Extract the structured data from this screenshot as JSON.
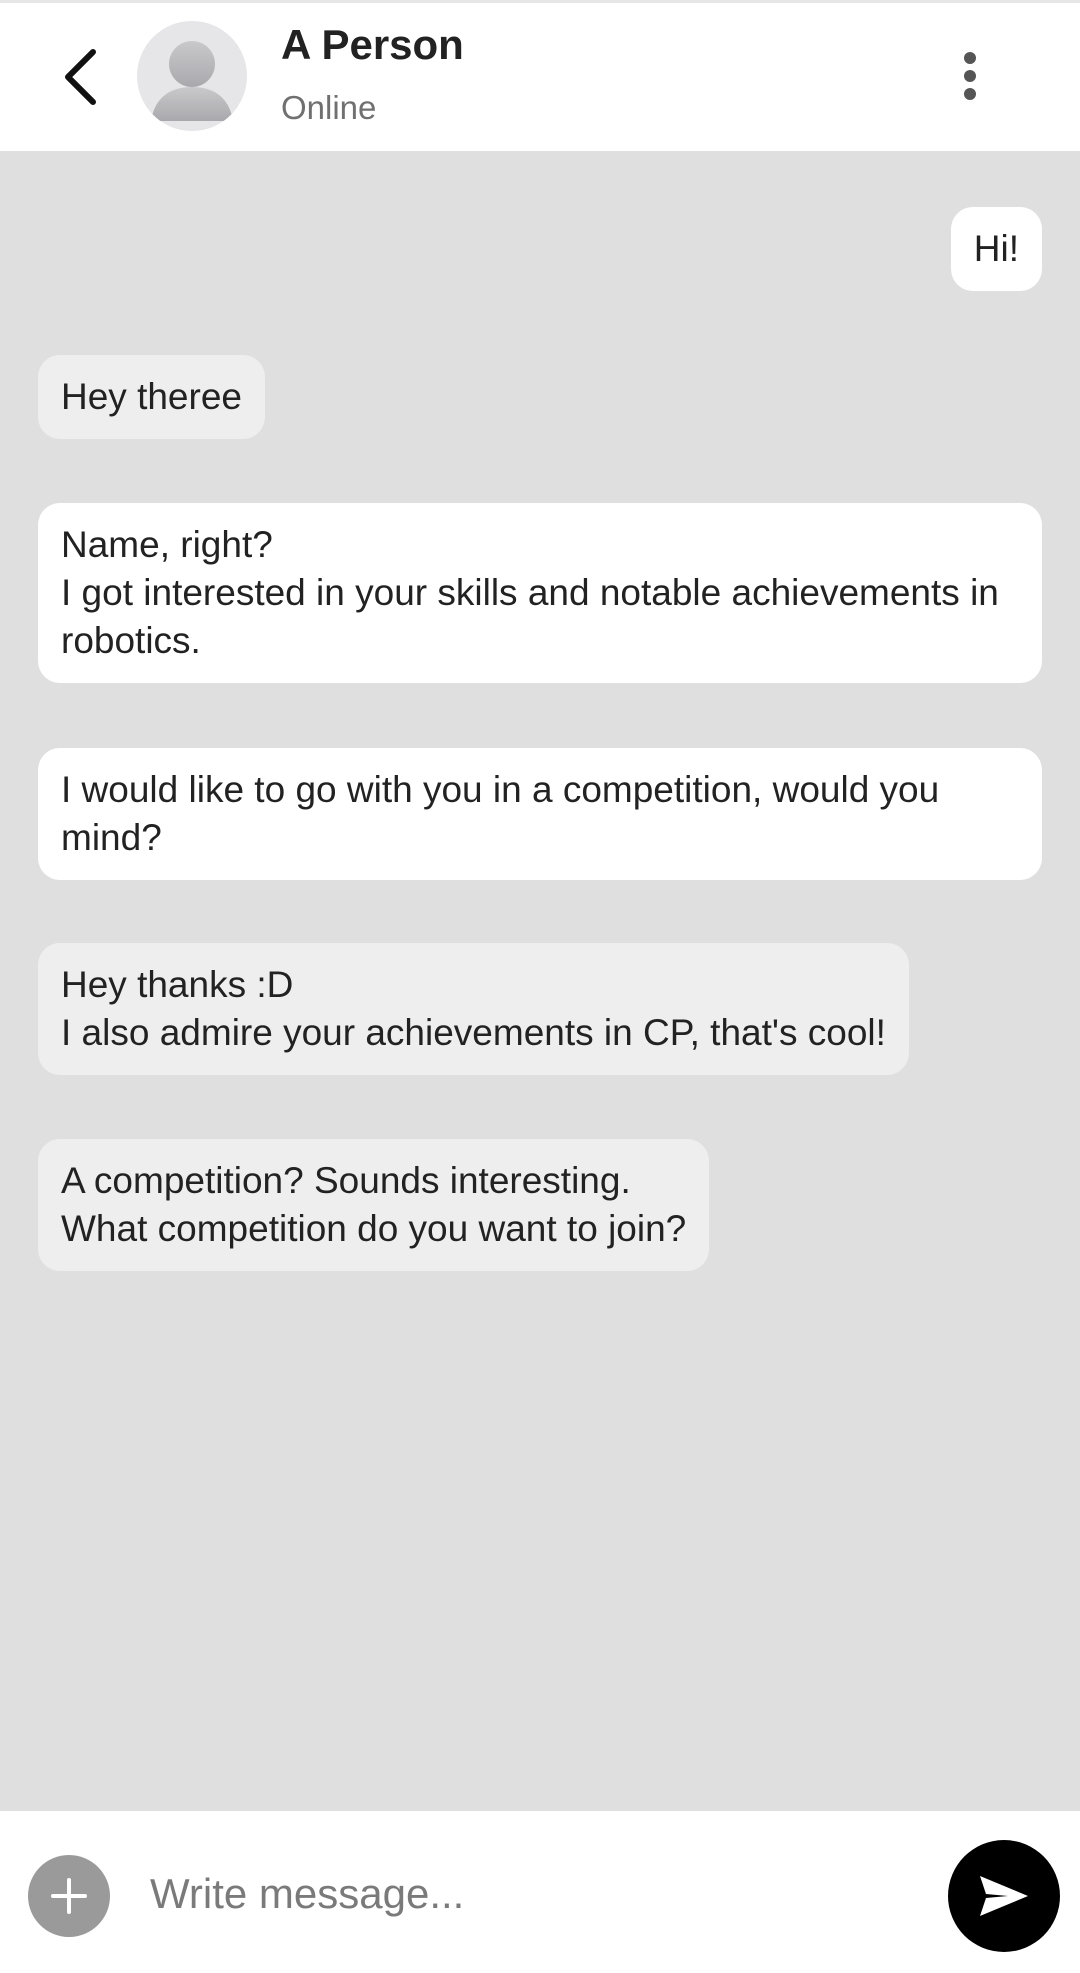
{
  "header": {
    "back_icon": "chevron-left-icon",
    "avatar_icon": "person-silhouette-icon",
    "contact_name": "A Person",
    "status": "Online",
    "menu_icon": "more-vertical-icon"
  },
  "messages": [
    {
      "direction": "outgoing",
      "text": "Hi!"
    },
    {
      "direction": "incoming",
      "text": "Hey theree"
    },
    {
      "direction": "outgoing",
      "text": "Name, right?\nI got interested in your skills and notable achievements in robotics."
    },
    {
      "direction": "outgoing",
      "text": "I would like to go with you in a competition, would you mind?"
    },
    {
      "direction": "incoming",
      "text": "Hey thanks :D\nI also admire your achievements in CP, that's cool!"
    },
    {
      "direction": "incoming",
      "text": "A competition? Sounds interesting.\nWhat competition do you want to join?"
    }
  ],
  "composer": {
    "attach_icon": "plus-icon",
    "placeholder": "Write message...",
    "value": "",
    "send_icon": "send-icon"
  },
  "colors": {
    "chat_background": "#dfdfdf",
    "outgoing_bubble": "#ffffff",
    "incoming_bubble": "#eeeeee",
    "send_button": "#000000",
    "attach_button": "#9a9a9a"
  }
}
